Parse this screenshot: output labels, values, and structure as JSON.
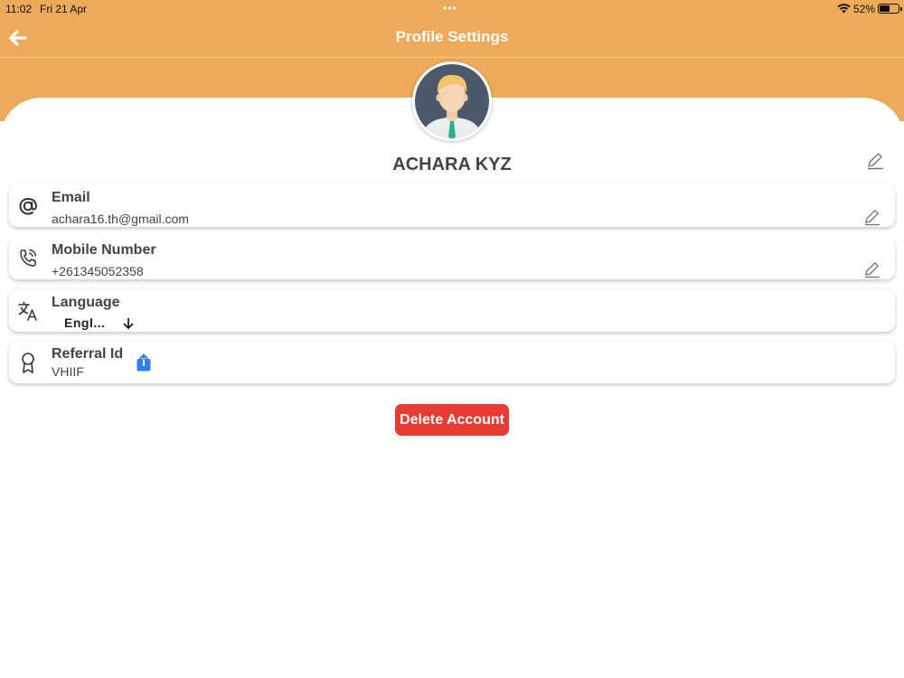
{
  "status_bar": {
    "time": "11:02",
    "date": "Fri 21 Apr",
    "battery": "52%",
    "dots": "•••"
  },
  "header": {
    "title": "Profile Settings"
  },
  "profile": {
    "name": "ACHARA KYZ"
  },
  "fields": {
    "email": {
      "label": "Email",
      "value": "achara16.th@gmail.com"
    },
    "mobile": {
      "label": "Mobile Number",
      "value": "+261345052358"
    },
    "language": {
      "label": "Language",
      "value": "Engl..."
    },
    "referral": {
      "label": "Referral Id",
      "value": "VHIIF"
    }
  },
  "actions": {
    "delete_label": "Delete Account"
  },
  "colors": {
    "header": "#EDAA58",
    "delete": "#EA3B32",
    "share": "#2F80ED",
    "text": "#444444"
  },
  "icons": [
    "back-arrow-icon",
    "avatar-icon",
    "edit-pencil-icon",
    "at-sign-icon",
    "phone-icon",
    "translate-icon",
    "arrow-down-icon",
    "award-ribbon-icon",
    "share-icon",
    "wifi-icon",
    "battery-icon"
  ]
}
